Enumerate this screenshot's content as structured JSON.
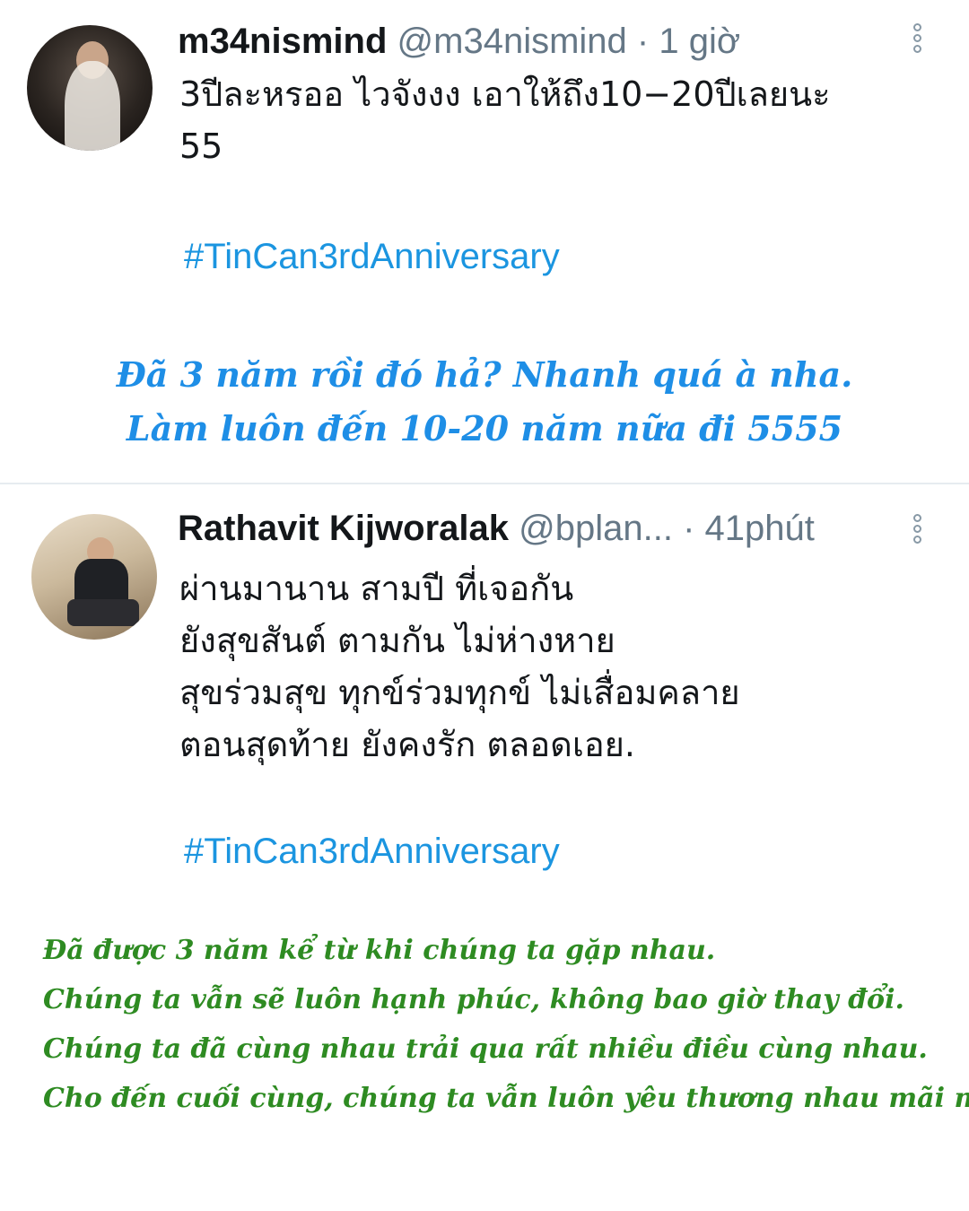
{
  "tweets": [
    {
      "display_name": "m34nismind",
      "handle": "@m34nismind",
      "separator": "·",
      "time": "1 giờ",
      "lines": [
        "3ปีละหรออ ไวจังงง เอาให้ถึง10−20ปีเลยนะ",
        "55"
      ],
      "hashtag": "#TinCan3rdAnniversary"
    },
    {
      "display_name": "Rathavit Kijworalak",
      "handle": "@bplan...",
      "separator": "·",
      "time": "41phút",
      "lines": [
        "ผ่านมานาน สามปี ที่เจอกัน",
        "ยังสุขสันต์ ตามกัน ไม่ห่างหาย",
        "สุขร่วมสุข ทุกข์ร่วมทุกข์ ไม่เสื่อมคลาย",
        "ตอนสุดท้าย ยังคงรัก ตลอดเอย."
      ],
      "hashtag": "#TinCan3rdAnniversary"
    }
  ],
  "captions": {
    "first": [
      "Đã 3 năm rồi đó hả? Nhanh quá à nha.",
      "Làm luôn đến 10-20 năm nữa đi 5555"
    ],
    "second": [
      "Đã được 3 năm kể từ khi chúng ta gặp nhau.",
      "Chúng ta vẫn sẽ luôn hạnh phúc, không bao giờ thay đổi.",
      "Chúng ta đã cùng nhau trải qua rất nhiều điều cùng nhau.",
      "Cho đến cuối cùng, chúng ta vẫn luôn yêu thương nhau mãi mãi"
    ]
  },
  "colors": {
    "hashtag": "#1b95e0",
    "caption_first": "#1e8ee6",
    "caption_second": "#2e8b22",
    "meta_gray": "#657786"
  },
  "icons": [
    "more-vertical-icon"
  ]
}
